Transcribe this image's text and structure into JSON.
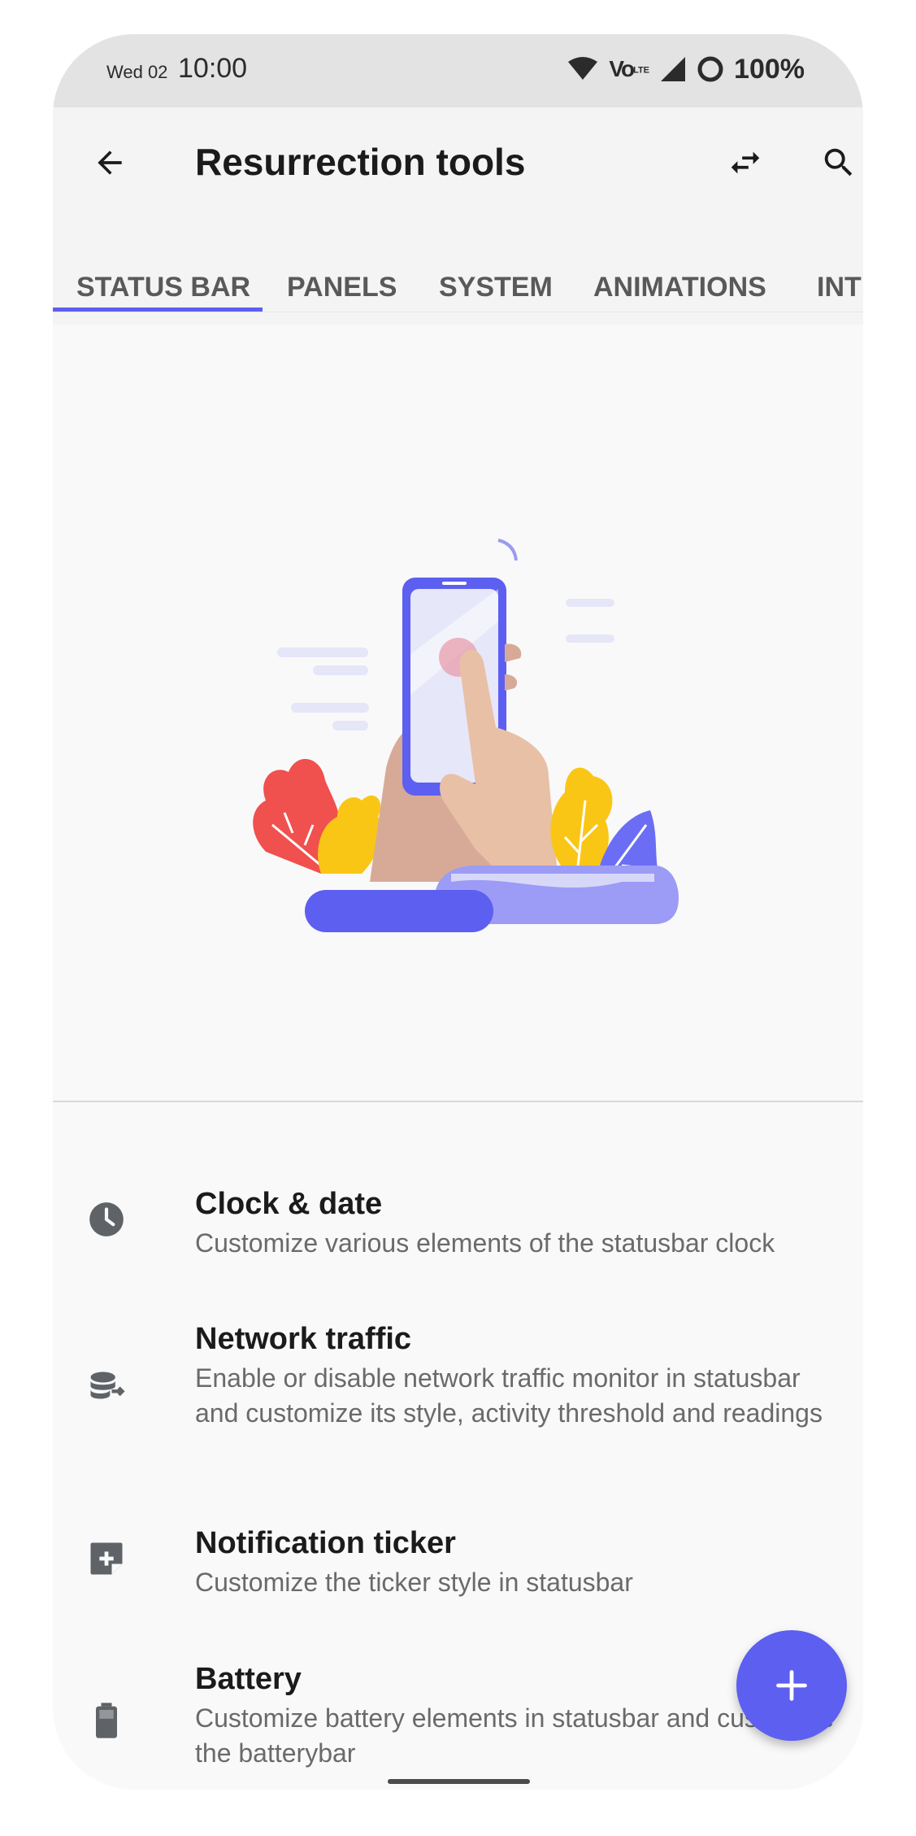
{
  "status_bar": {
    "date": "Wed 02",
    "time": "10:00",
    "volte": "Vo",
    "volte_sub": "LTE",
    "battery_percent": "100%"
  },
  "app_bar": {
    "title": "Resurrection tools",
    "back_icon": "arrow-back-icon",
    "swap_icon": "swap-arrows-icon",
    "search_icon": "search-icon"
  },
  "tabs": [
    {
      "label": "STATUS BAR",
      "selected": true
    },
    {
      "label": "PANELS",
      "selected": false
    },
    {
      "label": "SYSTEM",
      "selected": false
    },
    {
      "label": "ANIMATIONS",
      "selected": false
    },
    {
      "label": "INTE",
      "selected": false
    }
  ],
  "preferences": [
    {
      "icon": "clock-icon",
      "title": "Clock & date",
      "summary": "Customize various elements of the statusbar clock"
    },
    {
      "icon": "network-traffic-icon",
      "title": "Network traffic",
      "summary": "Enable or disable network traffic monitor in statusbar and customize its style, activity threshold and readings"
    },
    {
      "icon": "notification-ticker-icon",
      "title": "Notification ticker",
      "summary": "Customize the ticker style in statusbar"
    },
    {
      "icon": "battery-icon",
      "title": "Battery",
      "summary": "Customize battery elements in statusbar and customize the batterybar"
    }
  ],
  "fab": {
    "icon": "add-icon"
  },
  "colors": {
    "accent": "#5c5ff0",
    "status_bar_bg": "#e3e3e3",
    "app_bar_bg": "#f4f4f4",
    "background": "#f9f9f9"
  }
}
